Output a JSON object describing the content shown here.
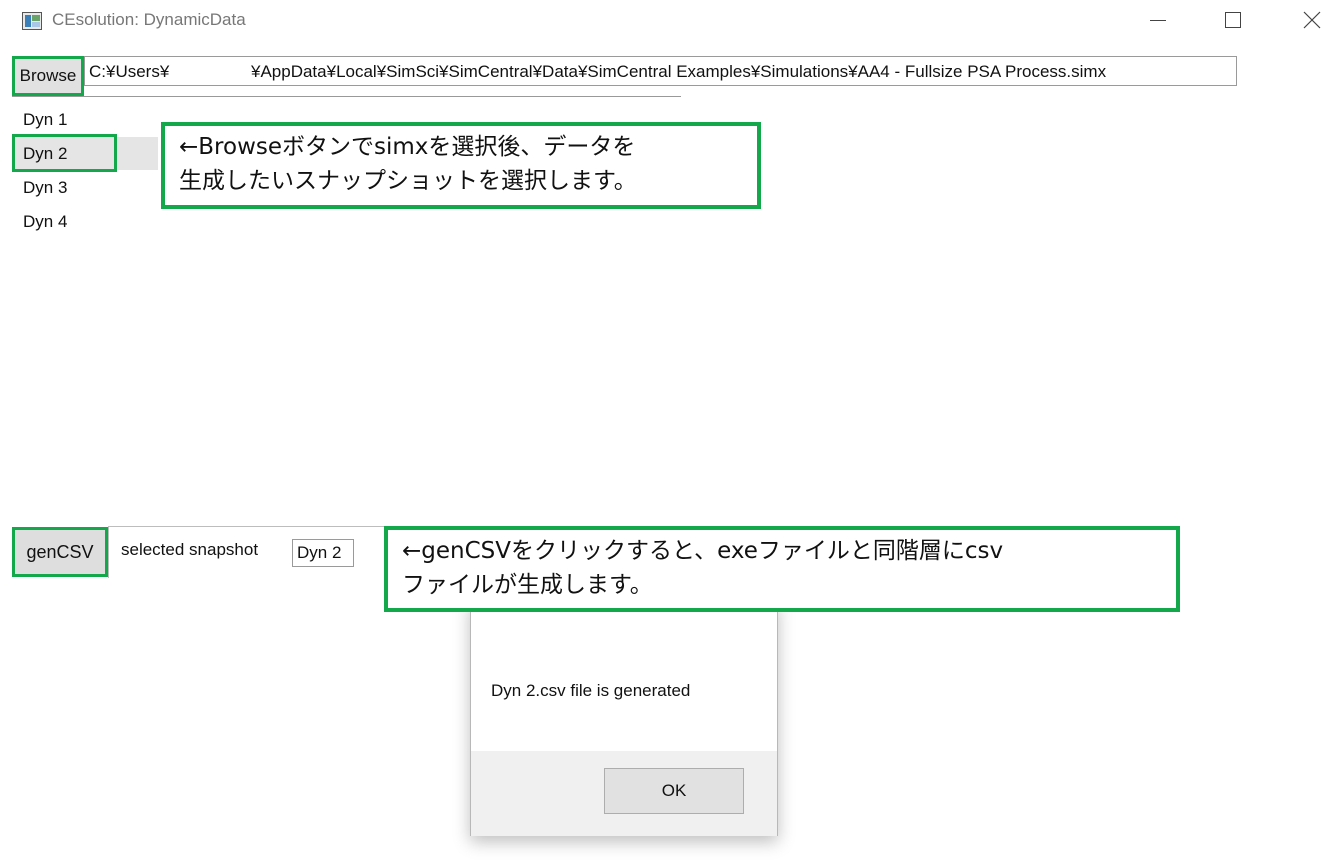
{
  "window": {
    "title": "CEsolution: DynamicData",
    "app_icon": "app-window-icon",
    "controls": [
      "minimize-icon",
      "maximize-icon",
      "close-icon"
    ]
  },
  "browse": {
    "button_label": "Browse",
    "path_start": "C:¥Users¥",
    "path_end": "¥AppData¥Local¥SimSci¥SimCentral¥Data¥SimCentral Examples¥Simulations¥AA4 - Fullsize PSA Process.simx"
  },
  "snapshots": {
    "items": [
      {
        "label": "Dyn 1"
      },
      {
        "label": "Dyn 2"
      },
      {
        "label": "Dyn 3"
      },
      {
        "label": "Dyn 4"
      }
    ],
    "selected": "Dyn 2"
  },
  "annotations": {
    "callout1_line1": "←Browseボタンでsimxを選択後、データを",
    "callout1_line2": "生成したいスナップショットを選択します。",
    "callout2_line1": "←genCSVをクリックすると、exeファイルと同階層にcsv",
    "callout2_line2": "ファイルが生成します。",
    "accent_color": "#13a84a"
  },
  "bottom": {
    "gencsv_label": "genCSV",
    "selected_label": "selected snapshot",
    "selected_value": "Dyn 2"
  },
  "dialog": {
    "message": "Dyn 2.csv file is generated",
    "ok_label": "OK"
  }
}
